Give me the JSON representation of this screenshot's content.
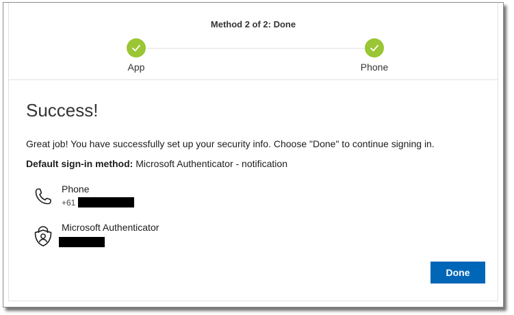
{
  "stepper": {
    "title": "Method 2 of 2: Done",
    "steps": [
      {
        "label": "App",
        "icon": "check-icon",
        "status": "complete"
      },
      {
        "label": "Phone",
        "icon": "check-icon",
        "status": "complete"
      }
    ],
    "check_color": "#9ac534"
  },
  "main": {
    "title": "Success!",
    "message": "Great job! You have successfully set up your security info. Choose \"Done\" to continue signing in.",
    "default_method_label": "Default sign-in method:",
    "default_method_value": " Microsoft Authenticator - notification",
    "methods": [
      {
        "name": "Phone",
        "detail_prefix": "+61",
        "icon": "phone-icon"
      },
      {
        "name": "Microsoft Authenticator",
        "detail_prefix": "",
        "icon": "authenticator-lock-icon"
      }
    ]
  },
  "footer": {
    "done_label": "Done",
    "accent_color": "#0067b8"
  }
}
